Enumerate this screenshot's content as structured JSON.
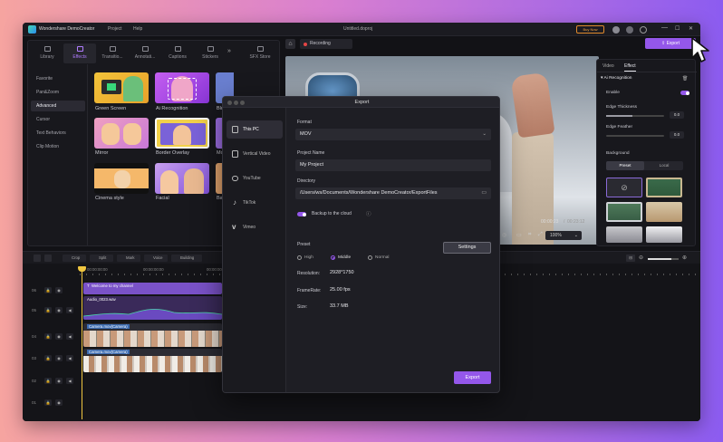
{
  "titlebar": {
    "app_name": "Wondershare DemoCreator",
    "menu": [
      "Project",
      "Help"
    ],
    "doc_title": "Untitled.doproj",
    "buy_now": "Buy Now",
    "window_controls": {
      "minimize": "—",
      "maximize": "☐",
      "close": "✕"
    }
  },
  "media_tabs": [
    {
      "label": "Library",
      "icon": "library-icon"
    },
    {
      "label": "Effects",
      "icon": "effects-icon",
      "active": true
    },
    {
      "label": "Transitio...",
      "icon": "transitions-icon"
    },
    {
      "label": "Annotati...",
      "icon": "annotations-icon"
    },
    {
      "label": "Captions",
      "icon": "captions-icon"
    },
    {
      "label": "Stickers",
      "icon": "stickers-icon"
    },
    {
      "label": "SFX Store",
      "icon": "sfx-store-icon"
    }
  ],
  "sidebar": {
    "items": [
      "Favorite",
      "Pan&Zoom",
      "Advanced",
      "Cursor",
      "Text Behaviors",
      "Clip Motion"
    ],
    "active": "Advanced"
  },
  "effects": {
    "row1": [
      "Green Screen",
      "Ai Recognition",
      "Blu"
    ],
    "row2": [
      "Mirror",
      "Border Overlay",
      "Mo"
    ],
    "row3": [
      "Cinema style",
      "Facial",
      "Ba"
    ]
  },
  "preview": {
    "recording_label": "Recording",
    "time_current": "00:00:23",
    "time_total": "00:23:12",
    "zoom": "100%"
  },
  "export_button": "Export",
  "right_panel": {
    "tabs": [
      "Video",
      "Effect"
    ],
    "section": "Ai Recognition",
    "enable_label": "Enable",
    "edge_thickness_label": "Edge Thickness",
    "edge_thickness_value": "0.0",
    "edge_thickness_fraction": 0.45,
    "edge_feather_label": "Edge Feather",
    "edge_feather_value": "0.0",
    "edge_feather_fraction": 0.0,
    "background_label": "Background",
    "preset_tab": "Preset",
    "local_tab": "Local"
  },
  "timeline": {
    "toolbar": [
      "Crop",
      "Split",
      "Mark",
      "Voice",
      "Building"
    ],
    "ruler": [
      "00:00:00:00",
      "00:00:00:00",
      "00:00:00:00",
      "00:00:00:00"
    ],
    "tracks": [
      "06",
      "05",
      "04",
      "03",
      "02",
      "01"
    ],
    "clips": {
      "title_clip": "Welcome to my channel",
      "audio_clip": "Audio_0023.wav",
      "camera_clip_1": "Camera.mov(Camera)",
      "camera_clip_2": "Camera.mov(Camera)"
    }
  },
  "export_dialog": {
    "title": "Export",
    "targets": [
      {
        "label": "This PC",
        "icon": "pc-icon",
        "active": true
      },
      {
        "label": "Vertical Video",
        "icon": "vertical-video-icon"
      },
      {
        "label": "YouTube",
        "icon": "youtube-icon"
      },
      {
        "label": "TikTok",
        "icon": "tiktok-icon"
      },
      {
        "label": "Vimeo",
        "icon": "vimeo-icon"
      }
    ],
    "format_label": "Format",
    "format_value": "MOV",
    "project_name_label": "Project Name",
    "project_name_value": "My Project",
    "directory_label": "Directory",
    "directory_value": "/Users/ws/Documents/Wondershare DemoCreator/ExportFiles",
    "backup_label": "Backup to the cloud",
    "preset_label": "Preset",
    "preset_options": [
      "High",
      "Middle",
      "Normal"
    ],
    "preset_selected": "Middle",
    "settings_button": "Settings",
    "resolution_label": "Resolution:",
    "resolution_value": "2928*1750",
    "framerate_label": "FrameRate:",
    "framerate_value": "25.00 fps",
    "size_label": "Size:",
    "size_value": "33.7 MB",
    "export_button": "Export"
  },
  "colors": {
    "accent": "#9457ea",
    "playhead": "#f0c640",
    "record": "#e54545"
  }
}
